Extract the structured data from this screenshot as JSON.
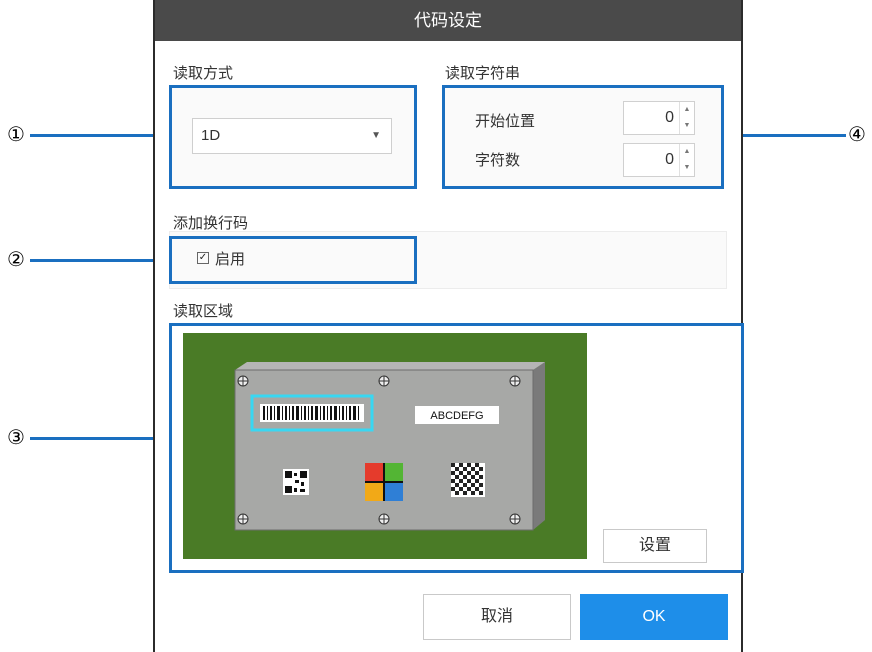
{
  "dialog": {
    "title": "代码设定"
  },
  "read_method": {
    "label": "读取方式",
    "selected": "1D"
  },
  "read_string": {
    "label": "读取字符串",
    "start_position_label": "开始位置",
    "start_position_value": "0",
    "char_count_label": "字符数",
    "char_count_value": "0"
  },
  "line_feed": {
    "label": "添加换行码",
    "enable_label": "启用",
    "enabled": true
  },
  "read_area": {
    "label": "读取区域",
    "set_button": "设置",
    "sample_text": "ABCDEFG"
  },
  "footer": {
    "cancel_label": "取消",
    "ok_label": "OK"
  },
  "callouts": [
    "①",
    "②",
    "③",
    "④"
  ],
  "colors": {
    "highlight": "#1a6fc0",
    "ok_button": "#1e8ee9",
    "titlebar": "#4a4a4a",
    "preview_bg": "#4a7b26"
  }
}
